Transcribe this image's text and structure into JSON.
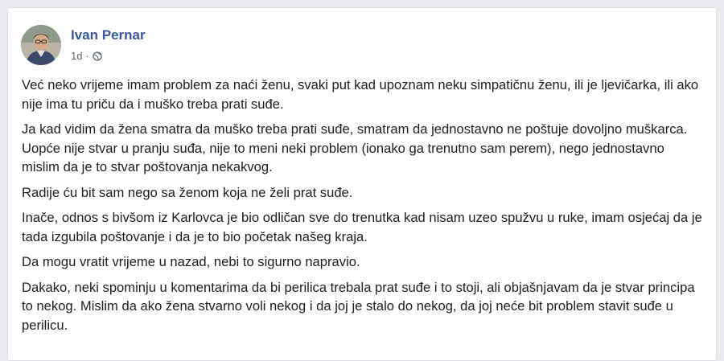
{
  "post": {
    "author": "Ivan Pernar",
    "timestamp": "1d",
    "separator": "·",
    "privacy_icon": "globe-icon",
    "paragraphs": [
      "Već neko vrijeme imam problem za naći ženu, svaki put kad upoznam neku simpatičnu ženu, ili je ljevičarka, ili ako nije ima tu priču da i muško treba prati suđe.",
      "Ja kad vidim da žena smatra da muško treba prati suđe, smatram da jednostavno ne poštuje dovoljno muškarca. Uopće nije stvar u pranju suđa, nije to meni neki problem (ionako ga trenutno sam perem), nego jednostavno mislim da je to stvar poštovanja nekakvog.",
      "Radije ću bit sam nego sa ženom koja ne želi prat suđe.",
      "Inače, odnos s bivšom iz Karlovca je bio odličan sve do trenutka kad nisam uzeo spužvu u ruke, imam osjećaj da je tada izgubila poštovanje i da je to bio početak našeg kraja.",
      "Da mogu vratit vrijeme u nazad, nebi to sigurno napravio.",
      "Dakako, neki spominju u komentarima da bi perilica trebala prat suđe i to stoji, ali objašnjavam da je stvar principa to nekog. Mislim da ako žena stvarno voli nekog i da joj je stalo do nekog, da joj neće bit problem stavit suđe u perilicu."
    ]
  },
  "colors": {
    "background": "#e9ebee",
    "card": "#ffffff",
    "author_link": "#385898",
    "meta_text": "#606770",
    "body_text": "#1c1e21"
  }
}
